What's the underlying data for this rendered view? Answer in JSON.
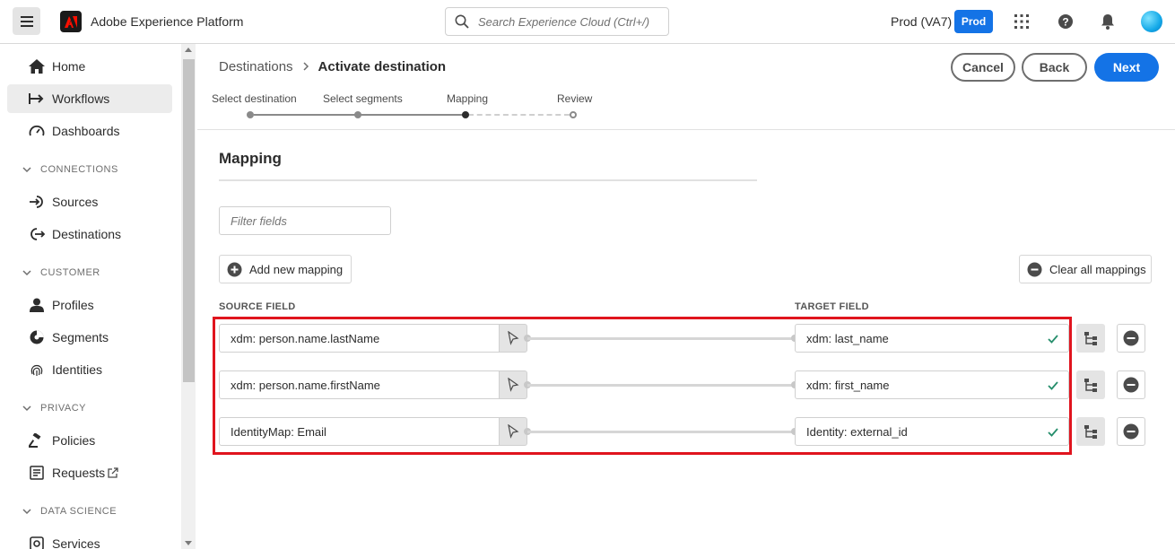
{
  "topbar": {
    "app_name": "Adobe Experience Platform",
    "search_placeholder": "Search Experience Cloud (Ctrl+/)",
    "org_name": "Prod (VA7)",
    "sandbox_badge": "Prod",
    "accent_color": "#1473e6"
  },
  "sidebar": {
    "items": [
      {
        "label": "Home",
        "icon": "home-icon"
      },
      {
        "label": "Workflows",
        "icon": "workflows-icon",
        "active": true
      },
      {
        "label": "Dashboards",
        "icon": "dashboard-icon"
      }
    ],
    "sections": [
      {
        "label": "CONNECTIONS",
        "items": [
          {
            "label": "Sources",
            "icon": "sources-icon"
          },
          {
            "label": "Destinations",
            "icon": "destinations-icon"
          }
        ]
      },
      {
        "label": "CUSTOMER",
        "items": [
          {
            "label": "Profiles",
            "icon": "profile-icon"
          },
          {
            "label": "Segments",
            "icon": "segments-icon"
          },
          {
            "label": "Identities",
            "icon": "fingerprint-icon"
          }
        ]
      },
      {
        "label": "PRIVACY",
        "items": [
          {
            "label": "Policies",
            "icon": "gavel-icon"
          },
          {
            "label": "Requests",
            "icon": "requests-icon"
          }
        ]
      },
      {
        "label": "DATA SCIENCE",
        "items": [
          {
            "label": "Services",
            "icon": "services-icon"
          }
        ]
      }
    ]
  },
  "header": {
    "breadcrumb": [
      "Destinations",
      "Activate destination"
    ],
    "buttons": {
      "cancel": "Cancel",
      "back": "Back",
      "next": "Next"
    },
    "steps": [
      {
        "label": "Select destination",
        "state": "done"
      },
      {
        "label": "Select segments",
        "state": "done"
      },
      {
        "label": "Mapping",
        "state": "current"
      },
      {
        "label": "Review",
        "state": "todo"
      }
    ]
  },
  "main": {
    "title": "Mapping",
    "filter_placeholder": "Filter fields",
    "add_mapping_label": "Add new mapping",
    "clear_mappings_label": "Clear all mappings",
    "source_column": "SOURCE FIELD",
    "target_column": "TARGET FIELD",
    "mappings": [
      {
        "source": "xdm: person.name.lastName",
        "target": "xdm: last_name"
      },
      {
        "source": "xdm: person.name.firstName",
        "target": "xdm: first_name"
      },
      {
        "source": "IdentityMap: Email",
        "target": "Identity: external_id"
      }
    ],
    "highlight_color": "#e0141e"
  }
}
